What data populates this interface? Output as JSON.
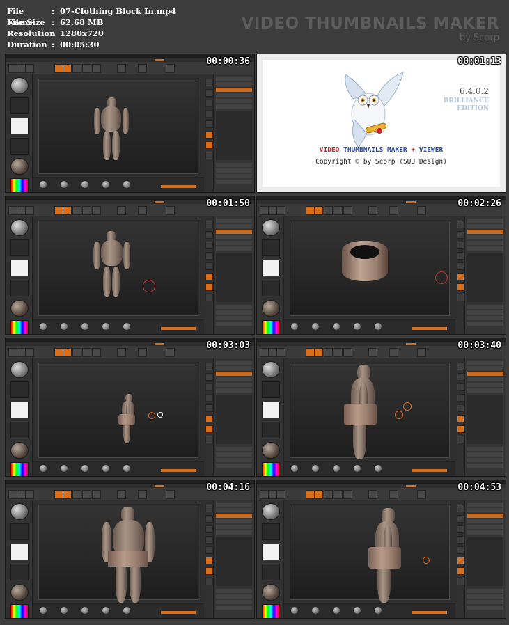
{
  "info": {
    "rows": [
      {
        "key": "File Name",
        "value": "07-Clothing Block In.mp4"
      },
      {
        "key": "File Size",
        "value": "62.68 MB"
      },
      {
        "key": "Resolution",
        "value": "1280x720"
      },
      {
        "key": "Duration",
        "value": "00:05:30"
      }
    ],
    "separator": ":"
  },
  "brand": {
    "title": "VIDEO THUMBNAILS MAKER",
    "subtitle": "by Scorp"
  },
  "thumbnails": [
    {
      "timestamp": "00:00:36",
      "scene": "full-figure-front"
    },
    {
      "timestamp": "00:01:13",
      "scene": "splash-screen"
    },
    {
      "timestamp": "00:01:50",
      "scene": "full-figure-front-brush-cursor"
    },
    {
      "timestamp": "00:02:26",
      "scene": "cylinder-ring"
    },
    {
      "timestamp": "00:03:03",
      "scene": "small-figure-with-skirt"
    },
    {
      "timestamp": "00:03:40",
      "scene": "side-view-figure-with-skirt"
    },
    {
      "timestamp": "00:04:16",
      "scene": "front-view-figure-with-skirt"
    },
    {
      "timestamp": "00:04:53",
      "scene": "side-view-large-cylinder"
    }
  ],
  "splash": {
    "version": "6.4.0.2",
    "edition_line1": "BRILLIANCE",
    "edition_line2": "EDITION",
    "title_part1": "VIDEO",
    "title_part2": "THUMBNAILS MAKER",
    "title_plus": "+",
    "title_part3": "VIEWER",
    "copyright": "Copyright © by Scorp (SUU Design)",
    "colors": {
      "red": "#c0262c",
      "blue": "#2a4aa0"
    }
  },
  "colors": {
    "accent": "#d86d1a",
    "background": "#3c3c3c",
    "brand_text": "#5c5c5c"
  }
}
